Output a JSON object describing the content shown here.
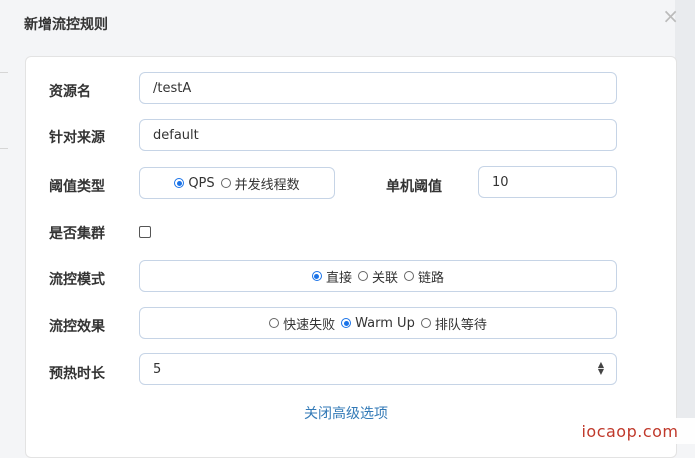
{
  "dialog": {
    "title": "新增流控规则",
    "close_label": "×"
  },
  "fields": {
    "resource_name": {
      "label": "资源名",
      "value": "/testA"
    },
    "limit_app": {
      "label": "针对来源",
      "value": "default"
    },
    "threshold_type": {
      "label": "阈值类型",
      "options": [
        "QPS",
        "并发线程数"
      ],
      "selected": "QPS"
    },
    "single_threshold": {
      "label": "单机阈值",
      "value": "10"
    },
    "cluster": {
      "label": "是否集群",
      "checked": false
    },
    "control_mode": {
      "label": "流控模式",
      "options": [
        "直接",
        "关联",
        "链路"
      ],
      "selected": "直接"
    },
    "control_effect": {
      "label": "流控效果",
      "options": [
        "快速失败",
        "Warm Up",
        "排队等待"
      ],
      "selected": "Warm Up"
    },
    "warmup_period": {
      "label": "预热时长",
      "value": "5"
    }
  },
  "advanced_toggle": "关闭高级选项",
  "watermark": "iocaop.com",
  "colors": {
    "accent": "#1a73e8",
    "link": "#337ab7",
    "border": "#c6d4e6",
    "watermark": "#c0392b"
  }
}
